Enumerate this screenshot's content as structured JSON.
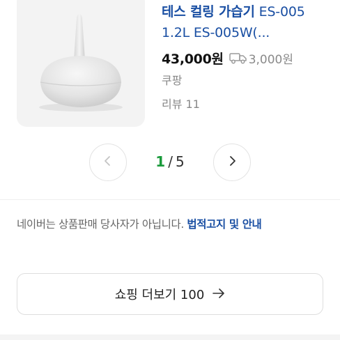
{
  "product": {
    "title_bold": "테스 컬링 가습기",
    "title_rest": " ES-005 1.2L ES-005W(...",
    "price": "43,000원",
    "shipping_icon": "truck-icon",
    "shipping_fee": "3,000원",
    "mall": "쿠팡",
    "reviews": "리뷰 11"
  },
  "pager": {
    "current": "1",
    "separator": "/",
    "total": "5",
    "prev_icon": "chevron-left-icon",
    "next_icon": "chevron-right-icon"
  },
  "notice": {
    "text": "네이버는 상품판매 당사자가 아닙니다. ",
    "link": "법적고지 및 안내"
  },
  "more_button": {
    "label": "쇼핑 더보기 100",
    "icon": "arrow-right-icon"
  },
  "colors": {
    "link_blue": "#1a4fa3",
    "current_page_green": "#1a9a3b",
    "muted_gray": "#888888"
  }
}
